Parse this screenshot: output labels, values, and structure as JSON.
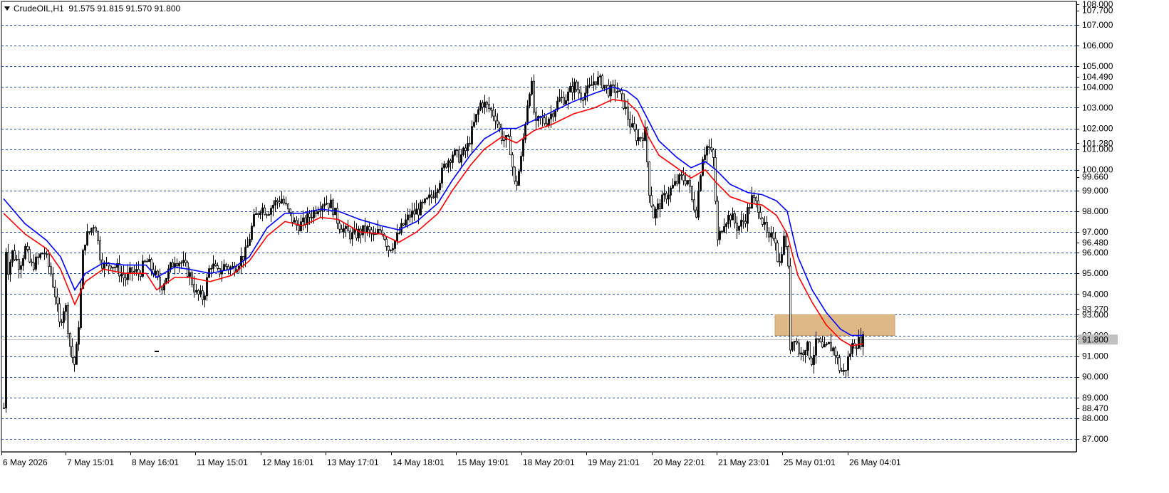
{
  "header": {
    "symbol_label": "CrudeOIL,H1",
    "ohlc": "91.575 91.815 91.570 91.800"
  },
  "chart_data": {
    "type": "candlestick",
    "symbol": "CrudeOIL",
    "timeframe": "H1",
    "current_price": 91.8,
    "ylim": [
      86.6,
      108.0
    ],
    "y_grid_levels": [
      87,
      88,
      89,
      90,
      91,
      92,
      93,
      94,
      95,
      96,
      97,
      98,
      99,
      100,
      101,
      102,
      103,
      104,
      105,
      106,
      107
    ],
    "y_tick_labels": [
      "108.000",
      "107.700",
      "107.000",
      "106.000",
      "105.000",
      "104.490",
      "104.000",
      "103.000",
      "102.000",
      "101.280",
      "101.000",
      "100.000",
      "99.660",
      "99.000",
      "98.000",
      "97.000",
      "96.480",
      "96.000",
      "95.000",
      "94.000",
      "93.270",
      "93.000",
      "92.000",
      "91.800",
      "91.000",
      "90.000",
      "89.000",
      "88.470",
      "88.000",
      "87.000"
    ],
    "y_tick_values": [
      108.0,
      107.7,
      107.0,
      106.0,
      105.0,
      104.49,
      104.0,
      103.0,
      102.0,
      101.28,
      101.0,
      100.0,
      99.66,
      99.0,
      98.0,
      97.0,
      96.48,
      96.0,
      95.0,
      94.0,
      93.27,
      93.0,
      92.0,
      91.8,
      91.0,
      90.0,
      89.0,
      88.47,
      88.0,
      87.0
    ],
    "x_tick_labels": [
      "6 May 2026",
      "7 May 15:01",
      "8 May 16:01",
      "11 May 15:01",
      "12 May 16:01",
      "13 May 17:01",
      "14 May 18:01",
      "15 May 19:01",
      "18 May 20:01",
      "19 May 21:01",
      "20 May 22:01",
      "21 May 23:01",
      "25 May 01:01",
      "26 May 04:01"
    ],
    "price_path": [
      [
        0,
        88.5
      ],
      [
        2,
        96.5
      ],
      [
        6,
        95.2
      ],
      [
        12,
        96.0
      ],
      [
        22,
        95.4
      ],
      [
        30,
        96.2
      ],
      [
        38,
        95.3
      ],
      [
        46,
        95.6
      ],
      [
        56,
        96.1
      ],
      [
        66,
        95.0
      ],
      [
        72,
        94.0
      ],
      [
        78,
        92.5
      ],
      [
        86,
        93.6
      ],
      [
        94,
        91.2
      ],
      [
        100,
        90.5
      ],
      [
        106,
        93.0
      ],
      [
        112,
        96.5
      ],
      [
        120,
        97.0
      ],
      [
        128,
        97.5
      ],
      [
        134,
        96.0
      ],
      [
        140,
        95.3
      ],
      [
        150,
        95.5
      ],
      [
        160,
        95.2
      ],
      [
        170,
        94.7
      ],
      [
        180,
        95.1
      ],
      [
        190,
        95.0
      ],
      [
        200,
        95.6
      ],
      [
        210,
        95.1
      ],
      [
        220,
        94.3
      ],
      [
        230,
        95.0
      ],
      [
        240,
        95.7
      ],
      [
        250,
        95.5
      ],
      [
        260,
        95.0
      ],
      [
        270,
        94.0
      ],
      [
        280,
        93.8
      ],
      [
        290,
        95.5
      ],
      [
        300,
        95.0
      ],
      [
        310,
        95.4
      ],
      [
        320,
        95.2
      ],
      [
        330,
        95.6
      ],
      [
        340,
        96.0
      ],
      [
        350,
        97.5
      ],
      [
        360,
        98.2
      ],
      [
        370,
        98.0
      ],
      [
        380,
        98.4
      ],
      [
        390,
        98.6
      ],
      [
        400,
        97.9
      ],
      [
        410,
        97.3
      ],
      [
        420,
        97.4
      ],
      [
        430,
        97.8
      ],
      [
        440,
        98.2
      ],
      [
        450,
        98.5
      ],
      [
        460,
        98.3
      ],
      [
        470,
        97.4
      ],
      [
        480,
        97.0
      ],
      [
        490,
        96.8
      ],
      [
        500,
        97.0
      ],
      [
        510,
        97.1
      ],
      [
        520,
        96.7
      ],
      [
        530,
        97.2
      ],
      [
        540,
        96.2
      ],
      [
        550,
        96.6
      ],
      [
        560,
        97.3
      ],
      [
        570,
        97.8
      ],
      [
        580,
        98.0
      ],
      [
        590,
        98.3
      ],
      [
        600,
        98.7
      ],
      [
        610,
        99.4
      ],
      [
        620,
        100.3
      ],
      [
        630,
        100.8
      ],
      [
        640,
        100.6
      ],
      [
        650,
        101.0
      ],
      [
        660,
        102.2
      ],
      [
        670,
        103.3
      ],
      [
        680,
        103.0
      ],
      [
        690,
        102.6
      ],
      [
        700,
        101.5
      ],
      [
        710,
        101.3
      ],
      [
        718,
        99.0
      ],
      [
        726,
        100.5
      ],
      [
        734,
        103.0
      ],
      [
        740,
        104.4
      ],
      [
        746,
        102.0
      ],
      [
        752,
        102.5
      ],
      [
        760,
        102.3
      ],
      [
        770,
        102.8
      ],
      [
        780,
        103.4
      ],
      [
        790,
        103.5
      ],
      [
        800,
        104.1
      ],
      [
        810,
        103.6
      ],
      [
        820,
        103.8
      ],
      [
        830,
        104.4
      ],
      [
        840,
        104.2
      ],
      [
        850,
        103.8
      ],
      [
        860,
        103.9
      ],
      [
        870,
        103.2
      ],
      [
        880,
        102.1
      ],
      [
        890,
        101.5
      ],
      [
        900,
        101.8
      ],
      [
        906,
        99.0
      ],
      [
        912,
        97.8
      ],
      [
        920,
        98.3
      ],
      [
        930,
        98.8
      ],
      [
        940,
        99.2
      ],
      [
        950,
        99.6
      ],
      [
        960,
        99.5
      ],
      [
        966,
        98.5
      ],
      [
        972,
        98.0
      ],
      [
        980,
        100.6
      ],
      [
        988,
        101.2
      ],
      [
        996,
        100.5
      ],
      [
        1002,
        96.5
      ],
      [
        1010,
        97.5
      ],
      [
        1020,
        97.8
      ],
      [
        1030,
        97.2
      ],
      [
        1040,
        97.6
      ],
      [
        1050,
        98.6
      ],
      [
        1060,
        98.2
      ],
      [
        1066,
        97.4
      ],
      [
        1074,
        96.5
      ],
      [
        1082,
        97.0
      ],
      [
        1088,
        95.2
      ],
      [
        1094,
        96.7
      ],
      [
        1100,
        96.3
      ],
      [
        1104,
        91.5
      ],
      [
        1110,
        92.0
      ],
      [
        1118,
        91.0
      ],
      [
        1126,
        91.6
      ],
      [
        1134,
        90.8
      ],
      [
        1142,
        91.8
      ],
      [
        1150,
        91.2
      ],
      [
        1158,
        91.5
      ],
      [
        1166,
        91.3
      ],
      [
        1174,
        90.3
      ],
      [
        1180,
        90.2
      ],
      [
        1186,
        91.0
      ],
      [
        1192,
        91.6
      ],
      [
        1200,
        91.7
      ],
      [
        1207,
        91.8
      ]
    ],
    "ema_fast": [
      [
        0,
        97.9
      ],
      [
        30,
        96.9
      ],
      [
        60,
        96.2
      ],
      [
        80,
        95.2
      ],
      [
        100,
        93.5
      ],
      [
        115,
        94.6
      ],
      [
        140,
        95.2
      ],
      [
        170,
        95.0
      ],
      [
        200,
        95.0
      ],
      [
        215,
        94.2
      ],
      [
        240,
        94.8
      ],
      [
        260,
        94.8
      ],
      [
        290,
        94.6
      ],
      [
        320,
        94.9
      ],
      [
        345,
        95.6
      ],
      [
        370,
        96.8
      ],
      [
        395,
        97.5
      ],
      [
        420,
        97.3
      ],
      [
        445,
        97.7
      ],
      [
        470,
        97.6
      ],
      [
        500,
        97.0
      ],
      [
        530,
        96.9
      ],
      [
        555,
        96.5
      ],
      [
        580,
        97.0
      ],
      [
        610,
        97.9
      ],
      [
        630,
        99.0
      ],
      [
        655,
        100.2
      ],
      [
        675,
        101.0
      ],
      [
        700,
        101.6
      ],
      [
        720,
        101.3
      ],
      [
        745,
        101.9
      ],
      [
        770,
        102.2
      ],
      [
        800,
        102.7
      ],
      [
        830,
        103.0
      ],
      [
        855,
        103.4
      ],
      [
        875,
        103.3
      ],
      [
        890,
        102.8
      ],
      [
        905,
        101.6
      ],
      [
        920,
        100.7
      ],
      [
        945,
        100.1
      ],
      [
        965,
        99.6
      ],
      [
        985,
        100.0
      ],
      [
        1000,
        99.4
      ],
      [
        1020,
        98.7
      ],
      [
        1045,
        98.4
      ],
      [
        1065,
        98.3
      ],
      [
        1085,
        97.8
      ],
      [
        1100,
        96.9
      ],
      [
        1115,
        94.9
      ],
      [
        1135,
        93.6
      ],
      [
        1155,
        92.5
      ],
      [
        1175,
        91.8
      ],
      [
        1190,
        91.5
      ],
      [
        1207,
        91.6
      ]
    ],
    "ema_slow": [
      [
        0,
        98.6
      ],
      [
        30,
        97.4
      ],
      [
        60,
        96.6
      ],
      [
        80,
        95.8
      ],
      [
        100,
        94.2
      ],
      [
        115,
        95.0
      ],
      [
        140,
        95.5
      ],
      [
        170,
        95.4
      ],
      [
        200,
        95.4
      ],
      [
        215,
        94.8
      ],
      [
        240,
        95.3
      ],
      [
        260,
        95.2
      ],
      [
        290,
        95.0
      ],
      [
        320,
        95.2
      ],
      [
        345,
        95.8
      ],
      [
        370,
        97.2
      ],
      [
        395,
        97.9
      ],
      [
        420,
        97.9
      ],
      [
        445,
        98.1
      ],
      [
        470,
        98.0
      ],
      [
        500,
        97.6
      ],
      [
        530,
        97.3
      ],
      [
        555,
        97.1
      ],
      [
        580,
        97.5
      ],
      [
        610,
        98.4
      ],
      [
        630,
        99.5
      ],
      [
        655,
        100.7
      ],
      [
        675,
        101.5
      ],
      [
        700,
        102.0
      ],
      [
        720,
        102.0
      ],
      [
        745,
        102.4
      ],
      [
        770,
        102.8
      ],
      [
        800,
        103.3
      ],
      [
        830,
        103.7
      ],
      [
        855,
        104.0
      ],
      [
        875,
        103.8
      ],
      [
        890,
        103.4
      ],
      [
        905,
        102.4
      ],
      [
        920,
        101.4
      ],
      [
        945,
        100.6
      ],
      [
        965,
        100.1
      ],
      [
        985,
        100.4
      ],
      [
        1000,
        100.0
      ],
      [
        1020,
        99.3
      ],
      [
        1045,
        98.9
      ],
      [
        1065,
        98.8
      ],
      [
        1085,
        98.5
      ],
      [
        1100,
        98.0
      ],
      [
        1115,
        95.8
      ],
      [
        1135,
        94.2
      ],
      [
        1155,
        93.1
      ],
      [
        1175,
        92.3
      ],
      [
        1190,
        92.0
      ],
      [
        1207,
        92.0
      ]
    ],
    "ema_fast_color": "#ff0000",
    "ema_slow_color": "#0000ff",
    "resistance_zone": {
      "from": 92.0,
      "to": 93.0,
      "color": "#deb887"
    },
    "grid": true,
    "grid_color": "#1f4fb4",
    "candle_color": "#000000",
    "price_line_color": "#c0c0c0"
  }
}
